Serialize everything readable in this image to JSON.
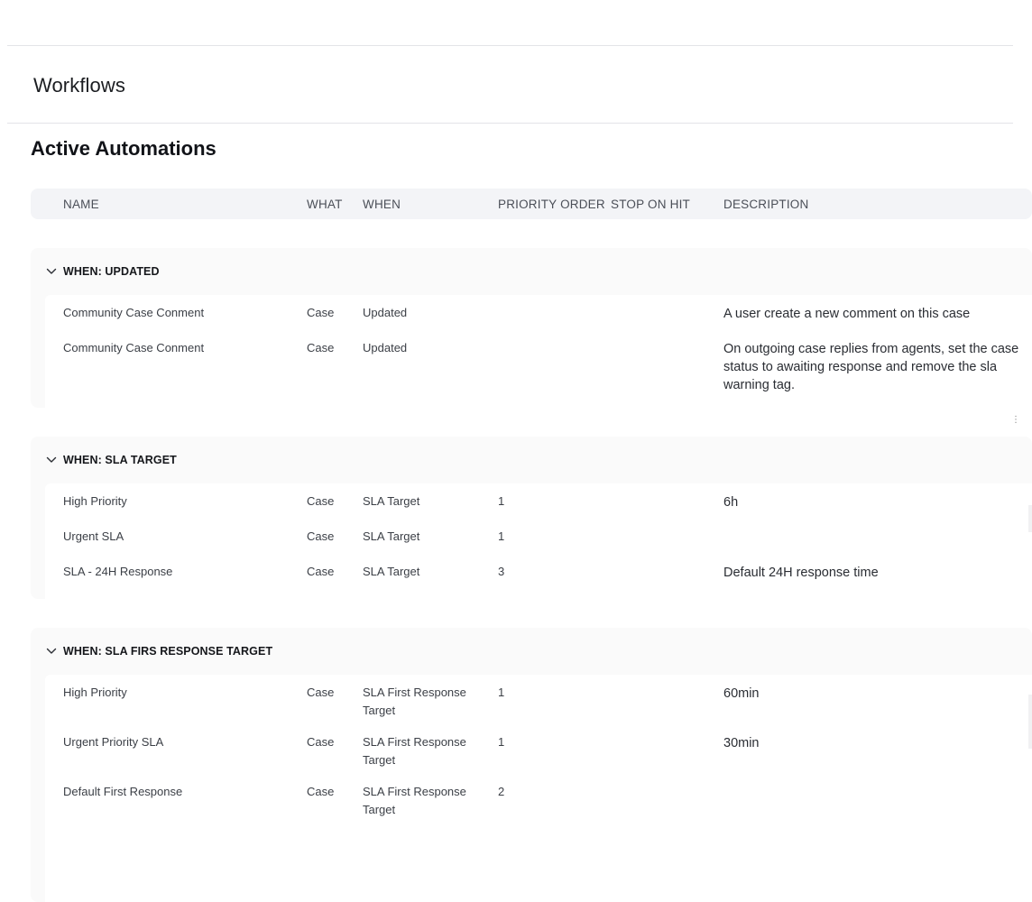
{
  "page": {
    "title": "Workflows",
    "section_title": "Active Automations"
  },
  "columns": {
    "name": "NAME",
    "what": "WHAT",
    "when": "WHEN",
    "priority": "PRIORITY ORDER",
    "stop": "STOP ON HIT",
    "description": "DESCRIPTION"
  },
  "groups": [
    {
      "label": "WHEN: UPDATED",
      "rows": [
        {
          "name": "Community Case Conment",
          "what": "Case",
          "when": "Updated",
          "priority": "",
          "stop": "",
          "description": "A user create a new comment on this case"
        },
        {
          "name": "Community Case Conment",
          "what": "Case",
          "when": "Updated",
          "priority": "",
          "stop": "",
          "description": "On outgoing case replies from agents, set the case status to awaiting response and remove the sla warning tag."
        }
      ]
    },
    {
      "label": "WHEN: SLA TARGET",
      "rows": [
        {
          "name": "High Priority",
          "what": "Case",
          "when": "SLA Target",
          "priority": "1",
          "stop": "",
          "description": "6h"
        },
        {
          "name": "Urgent SLA",
          "what": "Case",
          "when": "SLA Target",
          "priority": "1",
          "stop": "",
          "description": ""
        },
        {
          "name": "SLA - 24H Response",
          "what": "Case",
          "when": "SLA Target",
          "priority": "3",
          "stop": "",
          "description": "Default 24H response time"
        }
      ]
    },
    {
      "label": "WHEN: SLA FIRS RESPONSE TARGET",
      "rows": [
        {
          "name": "High Priority",
          "what": "Case",
          "when": "SLA First Response Target",
          "priority": "1",
          "stop": "",
          "description": "60min"
        },
        {
          "name": "Urgent Priority SLA",
          "what": "Case",
          "when": "SLA First Response Target",
          "priority": "1",
          "stop": "",
          "description": "30min"
        },
        {
          "name": "Default First Response",
          "what": "Case",
          "when": "SLA First Response Target",
          "priority": "2",
          "stop": "",
          "description": ""
        }
      ]
    }
  ],
  "icons": {
    "group_toggle": "chevron-down-icon"
  }
}
